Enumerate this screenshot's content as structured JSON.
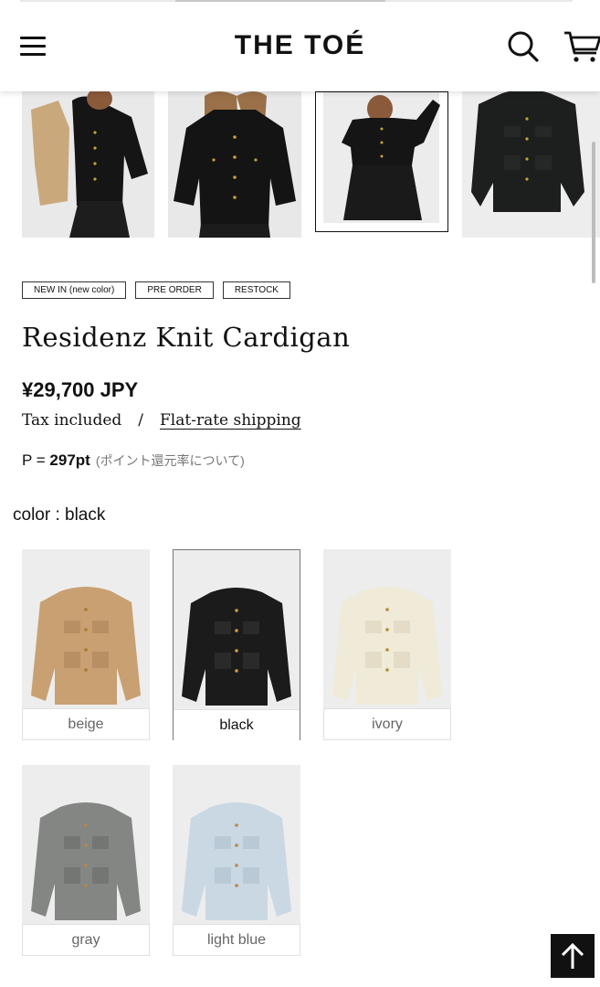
{
  "header": {
    "logo": "THE TOÉ",
    "icons": [
      "menu-icon",
      "search-icon",
      "cart-icon"
    ]
  },
  "badges": [
    "NEW IN (new color)",
    "PRE ORDER",
    "RESTOCK"
  ],
  "product": {
    "title": "Residenz Knit Cardigan",
    "price": "¥29,700 JPY",
    "tax_text": "Tax included",
    "separator": "/",
    "shipping_link": "Flat-rate shipping",
    "points_prefix": "P = ",
    "points_value": "297pt",
    "points_note": "(ポイント還元率について)"
  },
  "color": {
    "label": "color : black",
    "selected": "black",
    "options": [
      {
        "label": "beige",
        "hex": "#c9a072"
      },
      {
        "label": "black",
        "hex": "#1b1b1b"
      },
      {
        "label": "ivory",
        "hex": "#f0ead8"
      },
      {
        "label": "gray",
        "hex": "#838683"
      },
      {
        "label": "light blue",
        "hex": "#c9d8e3"
      }
    ]
  },
  "colors": {
    "text": "#111111",
    "thumb_bg": "#ededed",
    "gold_buttons": "#b8963e"
  }
}
